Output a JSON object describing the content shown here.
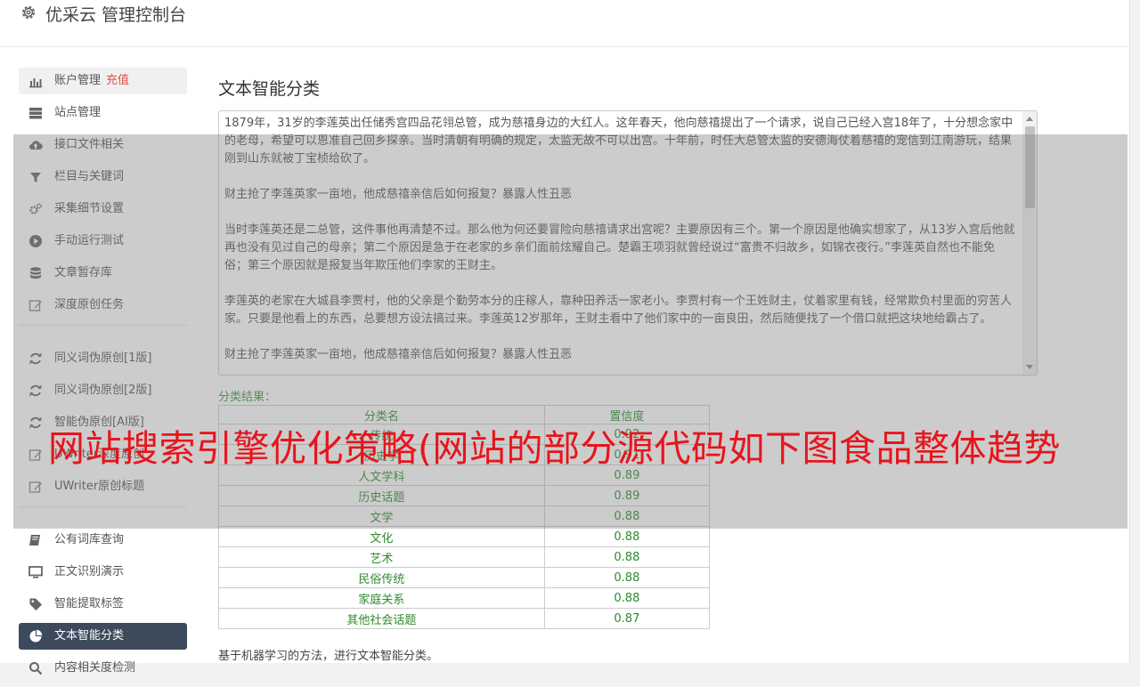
{
  "app": {
    "title": "优采云 管理控制台",
    "icon": "gear-icon"
  },
  "sidebar": {
    "items": [
      {
        "label": "账户管理",
        "extra": "充值",
        "icon": "bar-chart-icon",
        "state": "highlighted"
      },
      {
        "label": "站点管理",
        "icon": "server-icon"
      },
      {
        "label": "接口文件相关",
        "icon": "cloud-upload-icon"
      },
      {
        "label": "栏目与关键词",
        "icon": "filter-icon"
      },
      {
        "label": "采集细节设置",
        "icon": "cogs-icon"
      },
      {
        "label": "手动运行测试",
        "icon": "play-circle-icon"
      },
      {
        "label": "文章暂存库",
        "icon": "database-icon"
      },
      {
        "label": "深度原创任务",
        "icon": "edit-icon"
      },
      {
        "label": "同义词伪原创[1版]",
        "icon": "refresh-icon"
      },
      {
        "label": "同义词伪原创[2版]",
        "icon": "refresh-icon"
      },
      {
        "label": "智能伪原创[AI版]",
        "icon": "refresh-icon"
      },
      {
        "label": "UWriter深度原创",
        "icon": "edit-icon"
      },
      {
        "label": "UWriter原创标题",
        "icon": "edit-icon"
      },
      {
        "label": "公有词库查询",
        "icon": "book-icon"
      },
      {
        "label": "正文识别演示",
        "icon": "monitor-icon"
      },
      {
        "label": "智能提取标签",
        "icon": "tag-icon"
      },
      {
        "label": "文本智能分类",
        "icon": "pie-chart-icon",
        "state": "active"
      },
      {
        "label": "内容相关度检测",
        "icon": "search-icon"
      }
    ]
  },
  "main": {
    "title": "文本智能分类",
    "text_paragraphs": [
      "1879年，31岁的李莲英出任储秀宫四品花翎总管，成为慈禧身边的大红人。这年春天，他向慈禧提出了一个请求，说自己已经入宫18年了，十分想念家中的老母，希望可以恩准自己回乡探亲。当时清朝有明确的规定，太监无故不可以出宫。十年前，时任大总管太监的安德海仗着慈禧的宠信到江南游玩，结果刚到山东就被丁宝桢给砍了。",
      "财主抢了李莲英家一亩地，他成慈禧亲信后如何报复？暴露人性丑恶",
      "当时李莲英还是二总管，这件事他再清楚不过。那么他为何还要冒险向慈禧请求出宫呢？主要原因有三个。第一个原因是他确实想家了，从13岁入宫后他就再也没有见过自己的母亲；第二个原因是急于在老家的乡亲们面前炫耀自己。楚霸王项羽就曾经说过“富贵不归故乡，如锦衣夜行。”李莲英自然也不能免俗；第三个原因就是报复当年欺压他们李家的王财主。",
      "李莲英的老家在大城县李贾村，他的父亲是个勤劳本分的庄稼人，靠种田养活一家老小。李贾村有一个王姓财主，仗着家里有钱，经常欺负村里面的穷苦人家。只要是他看上的东西，总要想方设法搞过来。李莲英12岁那年，王财主看中了他们家中的一亩良田，然后随便找了一个借口就把这块地给霸占了。",
      "财主抢了李莲英家一亩地，他成慈禧亲信后如何报复？暴露人性丑恶"
    ],
    "result_label": "分类结果：",
    "table": {
      "headers": [
        "分类名",
        "置信度"
      ],
      "rows": [
        [
          "传统",
          "0.92"
        ],
        [
          "历史学",
          "0.91"
        ],
        [
          "人文学科",
          "0.89"
        ],
        [
          "历史话题",
          "0.89"
        ],
        [
          "文学",
          "0.88"
        ],
        [
          "文化",
          "0.88"
        ],
        [
          "艺术",
          "0.88"
        ],
        [
          "民俗传统",
          "0.88"
        ],
        [
          "家庭关系",
          "0.88"
        ],
        [
          "其他社会话题",
          "0.87"
        ]
      ]
    },
    "note": "基于机器学习的方法，进行文本智能分类。"
  },
  "watermark": "网站搜索引擎优化策略(网站的部分源代码如下图食品整体趋势",
  "colors": {
    "active_nav": "#3c4a5c",
    "result_green": "#2e8b2e",
    "recharge_red": "#d9534f",
    "watermark_red": "#e8141c"
  }
}
